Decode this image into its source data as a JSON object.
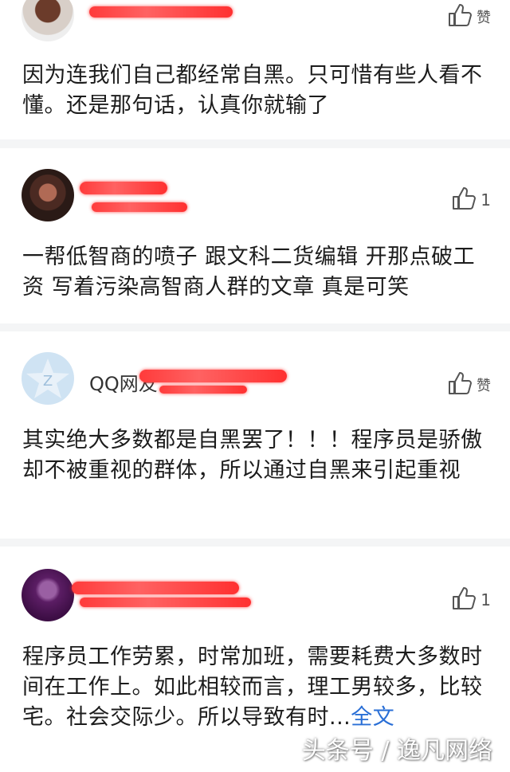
{
  "comments": [
    {
      "name": "",
      "like_label": "赞",
      "like_count": "",
      "text": "因为连我们自己都经常自黑。只可惜有些人看不懂。还是那句话，认真你就输了"
    },
    {
      "name": "",
      "like_label": "",
      "like_count": "1",
      "text": "一帮低智商的喷子 跟文科二货编辑 开那点破工资 写着污染高智商人群的文章 真是可笑"
    },
    {
      "name": "QQ网友",
      "like_label": "赞",
      "like_count": "",
      "text": "其实绝大多数都是自黑罢了！！！程序员是骄傲却不被重视的群体，所以通过自黑来引起重视"
    },
    {
      "name": "",
      "like_label": "",
      "like_count": "1",
      "text": "程序员工作劳累，时常加班，需要耗费大多数时间在工作上。如此相较而言，理工男较多，比较宅。社会交际少。所以导致有时...",
      "full_text_link": "全文"
    }
  ],
  "watermark": "头条号 / 逸凡网络",
  "colors": {
    "link": "#2a6fd6",
    "redaction": "#ff3b3b",
    "background": "#f4f5f6"
  },
  "icons": [
    "thumbs-up-icon"
  ]
}
